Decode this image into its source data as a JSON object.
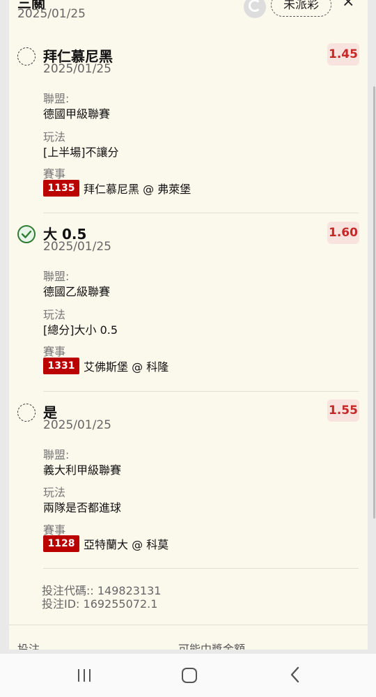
{
  "header": {
    "title": "三關",
    "date": "2025/01/25",
    "status": "未派彩",
    "close_symbol": "×",
    "refresh_icon": "refresh-icon"
  },
  "labels": {
    "league": "聯盟:",
    "market": "玩法",
    "event": "賽事"
  },
  "bets": [
    {
      "selection": "拜仁慕尼黑",
      "date": "2025/01/25",
      "odds": "1.45",
      "status_icon": "pending-circle-icon",
      "league": "德國甲級聯賽",
      "market": "[上半場]不讓分",
      "event_code": "1135",
      "event_name": "拜仁慕尼黑 @ 弗萊堡"
    },
    {
      "selection": "大 0.5",
      "date": "2025/01/25",
      "odds": "1.60",
      "status_icon": "checkmark-circle-icon",
      "league": "德國乙級聯賽",
      "market": "[總分]大小 0.5",
      "event_code": "1331",
      "event_name": "艾佛斯堡 @ 科隆"
    },
    {
      "selection": "是",
      "date": "2025/01/25",
      "odds": "1.55",
      "status_icon": "pending-circle-icon",
      "league": "義大利甲級聯賽",
      "market": "兩隊是否都進球",
      "event_code": "1128",
      "event_name": "亞特蘭大 @ 科莫"
    }
  ],
  "meta": {
    "bet_code": "投注代碼:: 149823131",
    "bet_id": "投注ID: 169255072.1"
  },
  "footer": {
    "stake_label": "投注",
    "payout_label": "可能中獎金額"
  },
  "colors": {
    "panel_bg": "#fbf8ec",
    "odds_text": "#c62828",
    "odds_bg": "#f8e3df",
    "event_code_bg": "#bb0000",
    "check_green": "#2e7d32"
  }
}
